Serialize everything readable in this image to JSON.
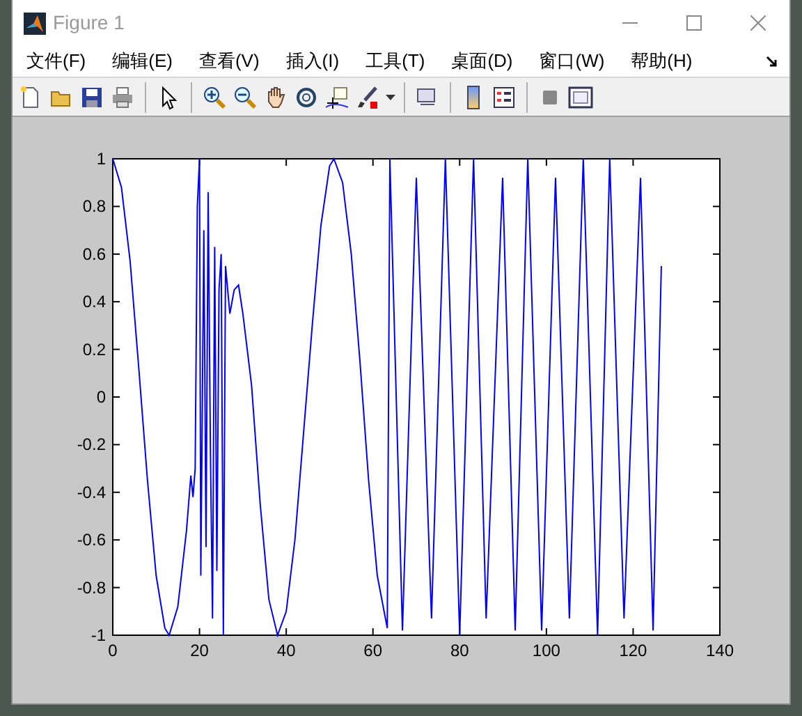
{
  "window": {
    "title": "Figure 1"
  },
  "menu": [
    "文件(F)",
    "编辑(E)",
    "查看(V)",
    "插入(I)",
    "工具(T)",
    "桌面(D)",
    "窗口(W)",
    "帮助(H)"
  ],
  "chart_data": {
    "type": "line",
    "xlim": [
      0,
      140
    ],
    "ylim": [
      -1,
      1
    ],
    "xticks": [
      0,
      20,
      40,
      60,
      80,
      100,
      120,
      140
    ],
    "yticks": [
      -1,
      -0.8,
      -0.6,
      -0.4,
      -0.2,
      0,
      0.2,
      0.4,
      0.6,
      0.8,
      1
    ],
    "x": [
      0,
      2,
      4,
      6,
      8,
      10,
      12,
      13,
      15,
      17,
      18,
      18.5,
      19,
      19.5,
      20,
      20.3,
      21,
      21.5,
      22,
      22.5,
      23,
      23.5,
      24,
      24.5,
      25,
      25.5,
      26,
      27,
      28,
      29,
      30,
      32,
      34,
      36,
      38,
      40,
      42,
      44,
      46,
      48,
      50,
      51,
      53,
      55,
      57,
      59,
      61,
      63.3,
      63.9,
      66.8,
      70,
      73.5,
      76.7,
      80,
      83.2,
      86.1,
      89.9,
      92.8,
      95.7,
      98.9,
      102.1,
      105.3,
      108.5,
      111.8,
      114.6,
      117.9,
      121.7,
      124.6,
      126.5
    ],
    "series": [
      {
        "color": "#0000ff",
        "values": [
          1,
          0.88,
          0.57,
          0.12,
          -0.35,
          -0.75,
          -0.97,
          -1,
          -0.88,
          -0.56,
          -0.33,
          -0.42,
          -0.3,
          0.8,
          1,
          -0.75,
          0.7,
          -0.63,
          0.86,
          -0.2,
          -0.93,
          0.63,
          -0.73,
          0.45,
          0.6,
          -1,
          0.55,
          0.35,
          0.45,
          0.47,
          0.35,
          0.05,
          -0.45,
          -0.85,
          -1,
          -0.9,
          -0.6,
          -0.15,
          0.3,
          0.72,
          0.97,
          1,
          0.9,
          0.6,
          0.15,
          -0.35,
          -0.75,
          -0.97,
          1,
          -0.98,
          0.92,
          -0.93,
          1,
          -1,
          1,
          -0.93,
          0.92,
          -0.98,
          1,
          -0.98,
          0.92,
          -0.93,
          1,
          -1,
          1,
          -0.93,
          0.92,
          -0.98,
          0.55
        ]
      }
    ]
  }
}
